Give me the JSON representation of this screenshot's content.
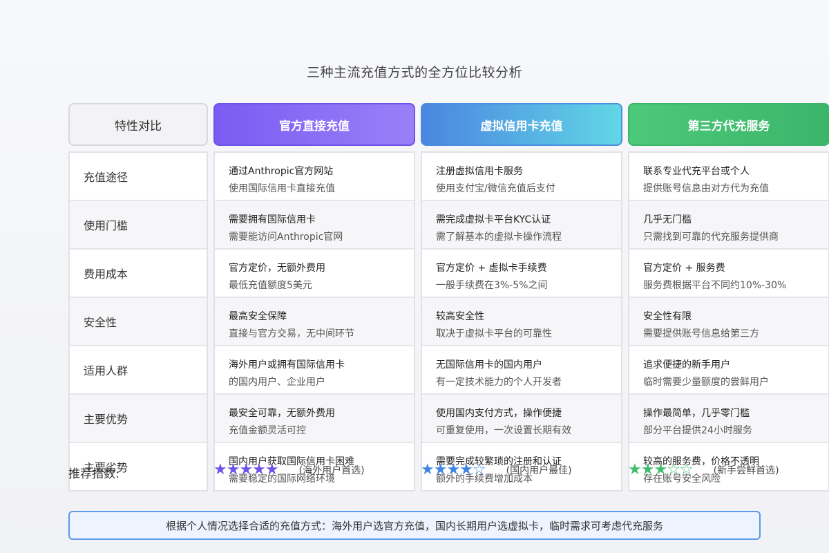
{
  "title": "三种主流充值方式的全方位比较分析",
  "headers": {
    "feature": "特性对比",
    "official": "官方直接充值",
    "virtual": "虚拟信用卡充值",
    "third": "第三方代充服务"
  },
  "colors": {
    "official": "#7a5cf3",
    "virtual": "#4a86e0",
    "third": "#4cc97a",
    "summary_border": "#5a9ae6"
  },
  "rows": [
    {
      "feature": "充值途径",
      "official": [
        "通过Anthropic官方网站",
        "使用国际信用卡直接充值"
      ],
      "virtual": [
        "注册虚拟信用卡服务",
        "使用支付宝/微信充值后支付"
      ],
      "third": [
        "联系专业代充平台或个人",
        "提供账号信息由对方代为充值"
      ]
    },
    {
      "feature": "使用门槛",
      "official": [
        "需要拥有国际信用卡",
        "需要能访问Anthropic官网"
      ],
      "virtual": [
        "需完成虚拟卡平台KYC认证",
        "需了解基本的虚拟卡操作流程"
      ],
      "third": [
        "几乎无门槛",
        "只需找到可靠的代充服务提供商"
      ]
    },
    {
      "feature": "费用成本",
      "official": [
        "官方定价，无额外费用",
        "最低充值额度5美元"
      ],
      "virtual": [
        "官方定价 + 虚拟卡手续费",
        "一般手续费在3%-5%之间"
      ],
      "third": [
        "官方定价 + 服务费",
        "服务费根据平台不同约10%-30%"
      ]
    },
    {
      "feature": "安全性",
      "official": [
        "最高安全保障",
        "直接与官方交易，无中间环节"
      ],
      "virtual": [
        "较高安全性",
        "取决于虚拟卡平台的可靠性"
      ],
      "third": [
        "安全性有限",
        "需要提供账号信息给第三方"
      ]
    },
    {
      "feature": "适用人群",
      "official": [
        "海外用户或拥有国际信用卡",
        "的国内用户、企业用户"
      ],
      "virtual": [
        "无国际信用卡的国内用户",
        "有一定技术能力的个人开发者"
      ],
      "third": [
        "追求便捷的新手用户",
        "临时需要少量额度的尝鲜用户"
      ]
    },
    {
      "feature": "主要优势",
      "official": [
        "最安全可靠，无额外费用",
        "充值金额灵活可控"
      ],
      "virtual": [
        "使用国内支付方式，操作便捷",
        "可重复使用，一次设置长期有效"
      ],
      "third": [
        "操作最简单，几乎零门槛",
        "部分平台提供24小时服务"
      ]
    },
    {
      "feature": "主要劣势",
      "official": [
        "国内用户获取国际信用卡困难",
        "需要稳定的国际网络环境"
      ],
      "virtual": [
        "需要完成较繁琐的注册和认证",
        "额外的手续费增加成本"
      ],
      "third": [
        "较高的服务费，价格不透明",
        "存在账号安全风险"
      ]
    }
  ],
  "recommendation": {
    "label": "推荐指数:",
    "official": {
      "stars": "★★★★★",
      "rating": 5,
      "note": "(海外用户首选)"
    },
    "virtual": {
      "stars": "★★★★☆",
      "rating": 4,
      "note": "(国内用户最佳)"
    },
    "third": {
      "stars": "★★★☆☆",
      "rating": 3,
      "note": "(新手尝鲜首选)"
    }
  },
  "summary": "根据个人情况选择合适的充值方式：海外用户选官方充值，国内长期用户选虚拟卡，临时需求可考虑代充服务"
}
